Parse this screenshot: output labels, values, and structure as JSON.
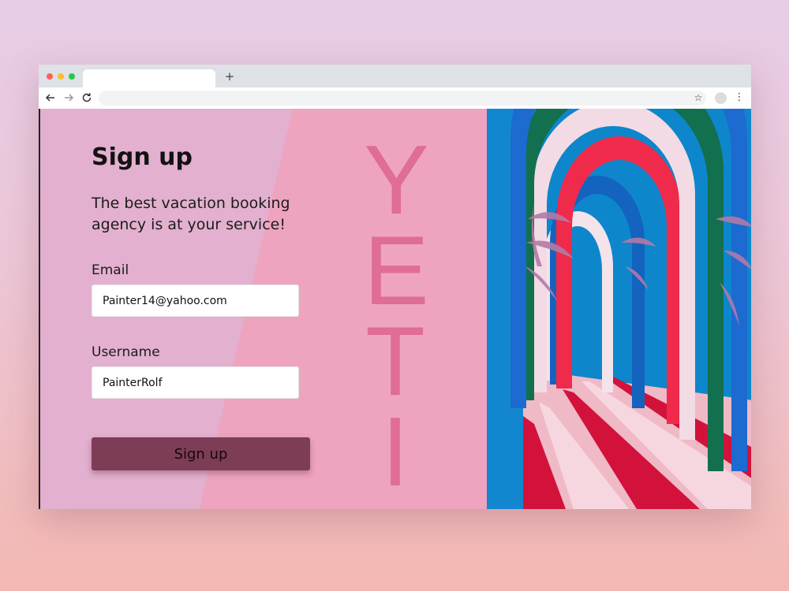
{
  "browser": {
    "new_tab_label": "+",
    "back_icon": "arrow-left-icon",
    "forward_icon": "arrow-right-icon",
    "reload_icon": "reload-icon",
    "bookmark_icon": "star-icon",
    "menu_icon": "kebab-menu-icon"
  },
  "signup": {
    "title": "Sign up",
    "subtitle": "The best vacation booking agency is at your service!",
    "email_label": "Email",
    "email_value": "Painter14@yahoo.com",
    "username_label": "Username",
    "username_value": "PainterRolf",
    "button_label": "Sign up"
  },
  "brand": {
    "letters": [
      "Y",
      "E",
      "T",
      "I"
    ]
  },
  "colors": {
    "left_bg": "#eea4bf",
    "wedge": "#e3b0cf",
    "accent_text": "#e06c98",
    "button": "#7d3d56"
  }
}
